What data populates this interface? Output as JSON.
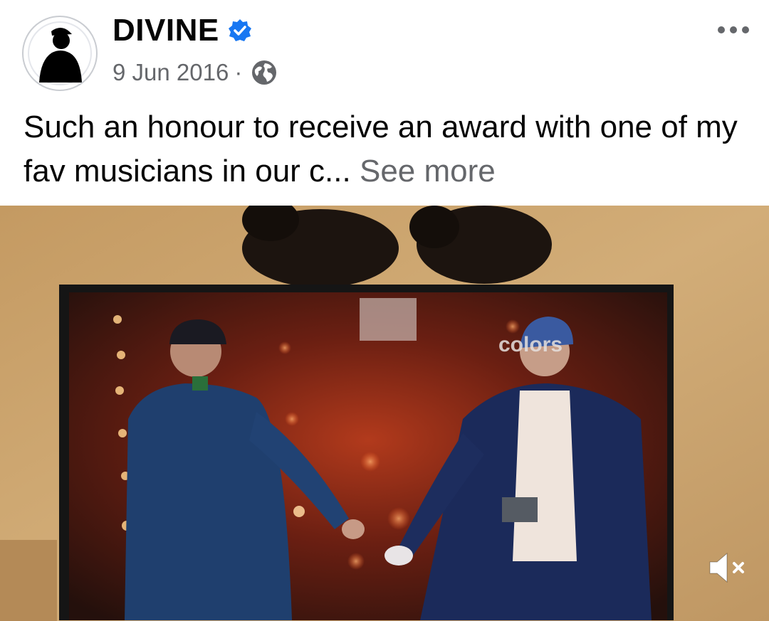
{
  "post": {
    "author": "DIVINE",
    "verified": true,
    "date": "9 Jun 2016",
    "separator": "·",
    "privacy_icon": "globe-icon",
    "caption": "Such an honour to receive an award with one of my fav musicians in our c...",
    "see_more": "See more",
    "more_icon": "more-horizontal-icon"
  },
  "video": {
    "on_screen_logo": "colors",
    "muted": true,
    "mute_icon": "speaker-muted-icon"
  },
  "colors": {
    "verified_blue": "#1877f2",
    "secondary_text": "#65676b",
    "primary_text": "#050505"
  }
}
